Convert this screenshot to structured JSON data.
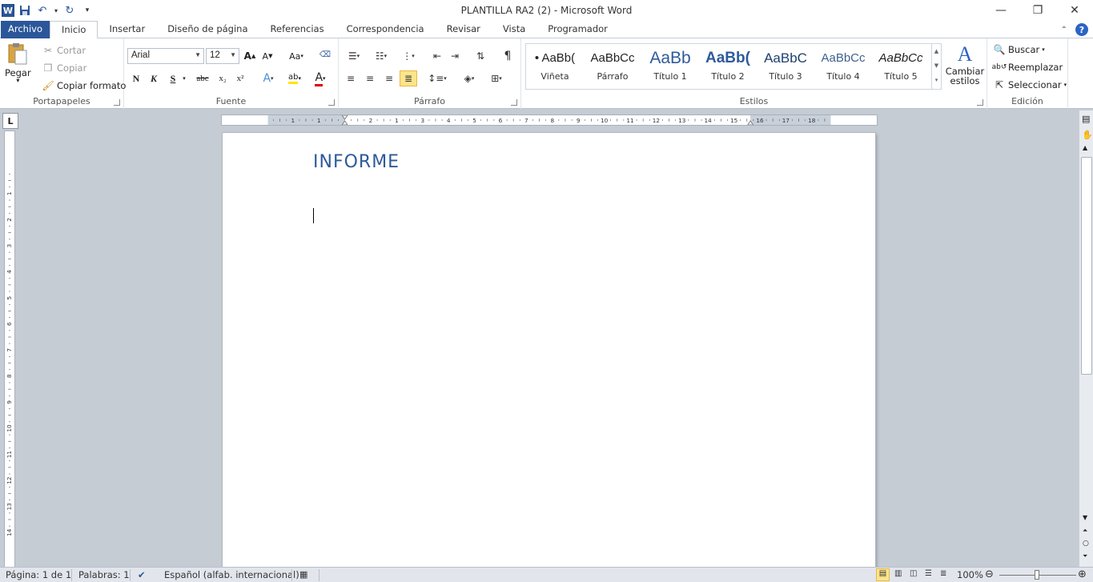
{
  "title_bar": {
    "title": "PLANTILLA RA2 (2)  -  Microsoft Word",
    "app_icon": "W"
  },
  "tabs": [
    {
      "label": "Archivo"
    },
    {
      "label": "Inicio"
    },
    {
      "label": "Insertar"
    },
    {
      "label": "Diseño de página"
    },
    {
      "label": "Referencias"
    },
    {
      "label": "Correspondencia"
    },
    {
      "label": "Revisar"
    },
    {
      "label": "Vista"
    },
    {
      "label": "Programador"
    }
  ],
  "clipboard": {
    "paste": "Pegar",
    "cut": "Cortar",
    "copy": "Copiar",
    "format_painter": "Copiar formato",
    "group": "Portapapeles"
  },
  "font": {
    "name": "Arial",
    "size": "12",
    "group": "Fuente",
    "bold": "N",
    "italic": "K",
    "underline": "S",
    "strike": "abc",
    "sub": "x₂",
    "sup": "x²",
    "grow": "A",
    "shrink": "A",
    "case": "Aa",
    "color_letter": "A",
    "effects_letter": "A"
  },
  "paragraph": {
    "group": "Párrafo",
    "pilcrow": "¶"
  },
  "styles": {
    "group": "Estilos",
    "items": [
      {
        "preview": "• AaBb(",
        "label": "Viñeta"
      },
      {
        "preview": "AaBbCc",
        "label": "Párrafo"
      },
      {
        "preview": "AaBb",
        "label": "Título 1"
      },
      {
        "preview": "AaBb(",
        "label": "Título 2"
      },
      {
        "preview": "AaBbC",
        "label": "Título 3"
      },
      {
        "preview": "AaBbCc",
        "label": "Título 4"
      },
      {
        "preview": "AaBbCc",
        "label": "Título 5"
      }
    ],
    "change": "Cambiar estilos"
  },
  "editing": {
    "group": "Edición",
    "find": "Buscar",
    "replace": "Reemplazar",
    "select": "Seleccionar"
  },
  "ruler": {
    "h_labels": [
      "1",
      "1",
      "2",
      "1",
      "3",
      "4",
      "5",
      "6",
      "7",
      "8",
      "9",
      "10",
      "11",
      "12",
      "13",
      "14",
      "15",
      "16",
      "17",
      "18"
    ],
    "v_labels": [
      "1",
      "1",
      "2",
      "3",
      "4",
      "5",
      "6",
      "7",
      "8",
      "9",
      "10",
      "11",
      "12",
      "13",
      "14"
    ]
  },
  "document": {
    "heading": "INFORME"
  },
  "status": {
    "page": "Página: 1 de 1",
    "words": "Palabras: 1",
    "language": "Español (alfab. internacional)",
    "zoom": "100%"
  },
  "colors": {
    "accent": "#2b579a",
    "heading": "#2e5a9a"
  }
}
